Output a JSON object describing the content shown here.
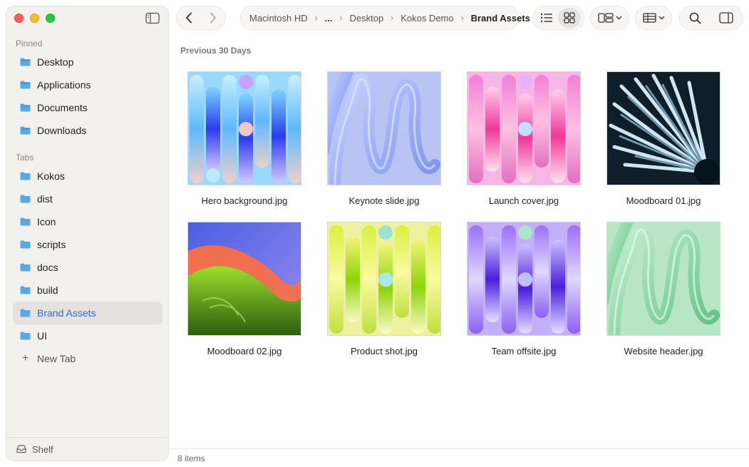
{
  "sidebar": {
    "pinned_label": "Pinned",
    "pinned": [
      {
        "label": "Desktop"
      },
      {
        "label": "Applications"
      },
      {
        "label": "Documents"
      },
      {
        "label": "Downloads"
      }
    ],
    "tabs_label": "Tabs",
    "tabs": [
      {
        "label": "Kokos"
      },
      {
        "label": "dist"
      },
      {
        "label": "Icon"
      },
      {
        "label": "scripts"
      },
      {
        "label": "docs"
      },
      {
        "label": "build"
      },
      {
        "label": "Brand Assets",
        "active": true
      },
      {
        "label": "UI"
      }
    ],
    "new_tab_label": "New Tab",
    "shelf_label": "Shelf"
  },
  "breadcrumb": [
    "Macintosh HD",
    "...",
    "Desktop",
    "Kokos Demo",
    "Brand Assets"
  ],
  "content": {
    "group_title": "Previous 30 Days",
    "files": [
      {
        "name": "Hero background.jpg"
      },
      {
        "name": "Keynote slide.jpg"
      },
      {
        "name": "Launch cover.jpg"
      },
      {
        "name": "Moodboard 01.jpg"
      },
      {
        "name": "Moodboard 02.jpg"
      },
      {
        "name": "Product shot.jpg"
      },
      {
        "name": "Team offsite.jpg"
      },
      {
        "name": "Website header.jpg"
      }
    ]
  },
  "status": {
    "item_count": "8 items"
  },
  "colors": {
    "accent": "#2a6de0",
    "folder": "#5aa9e6"
  }
}
